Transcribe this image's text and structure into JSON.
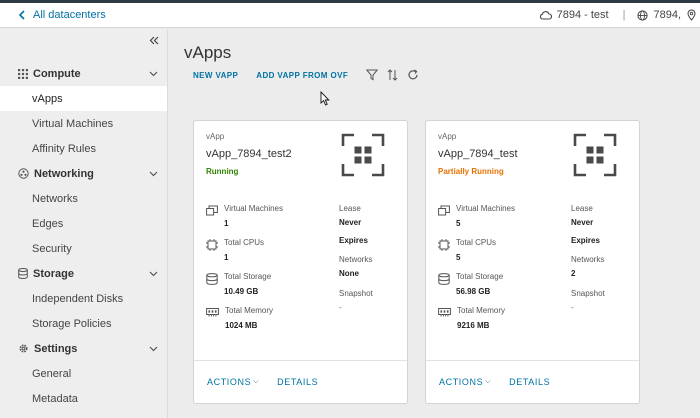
{
  "topbar": {
    "back_label": "All datacenters",
    "org": "7894 - test",
    "site": "7894,"
  },
  "sidebar": {
    "groups": [
      {
        "label": "Compute",
        "icon": "grid-icon",
        "items": [
          "vApps",
          "Virtual Machines",
          "Affinity Rules"
        ]
      },
      {
        "label": "Networking",
        "icon": "network-icon",
        "items": [
          "Networks",
          "Edges",
          "Security"
        ]
      },
      {
        "label": "Storage",
        "icon": "storage-icon",
        "items": [
          "Independent Disks",
          "Storage Policies"
        ]
      },
      {
        "label": "Settings",
        "icon": "gear-icon",
        "items": [
          "General",
          "Metadata"
        ]
      }
    ],
    "active_item": "vApps"
  },
  "main": {
    "title": "vApps",
    "toolbar": {
      "new_vapp": "NEW VAPP",
      "add_from_ovf": "ADD VAPP FROM OVF"
    },
    "cards": [
      {
        "type": "vApp",
        "name": "vApp_7894_test2",
        "status": "Running",
        "status_color": "#2f8400",
        "vms_label": "Virtual Machines",
        "vms": "1",
        "cpus_label": "Total CPUs",
        "cpus": "1",
        "storage_label": "Total Storage",
        "storage": "10.49 GB",
        "memory_label": "Total Memory",
        "memory": "1024 MB",
        "lease_label": "Lease",
        "lease": "Never",
        "expires": "Expires",
        "networks_label": "Networks",
        "networks": "None",
        "snapshot_label": "Snapshot",
        "snapshot": "-",
        "actions": "ACTIONS",
        "details": "DETAILS"
      },
      {
        "type": "vApp",
        "name": "vApp_7894_test",
        "status": "Partially Running",
        "status_color": "#e57200",
        "vms_label": "Virtual Machines",
        "vms": "5",
        "cpus_label": "Total CPUs",
        "cpus": "5",
        "storage_label": "Total Storage",
        "storage": "56.98 GB",
        "memory_label": "Total Memory",
        "memory": "9216 MB",
        "lease_label": "Lease",
        "lease": "Never",
        "expires": "Expires",
        "networks_label": "Networks",
        "networks": "2",
        "snapshot_label": "Snapshot",
        "snapshot": "-",
        "actions": "ACTIONS",
        "details": "DETAILS"
      }
    ]
  },
  "colors": {
    "accent": "#0072a3",
    "running": "#2f8400",
    "partial": "#e57200"
  }
}
